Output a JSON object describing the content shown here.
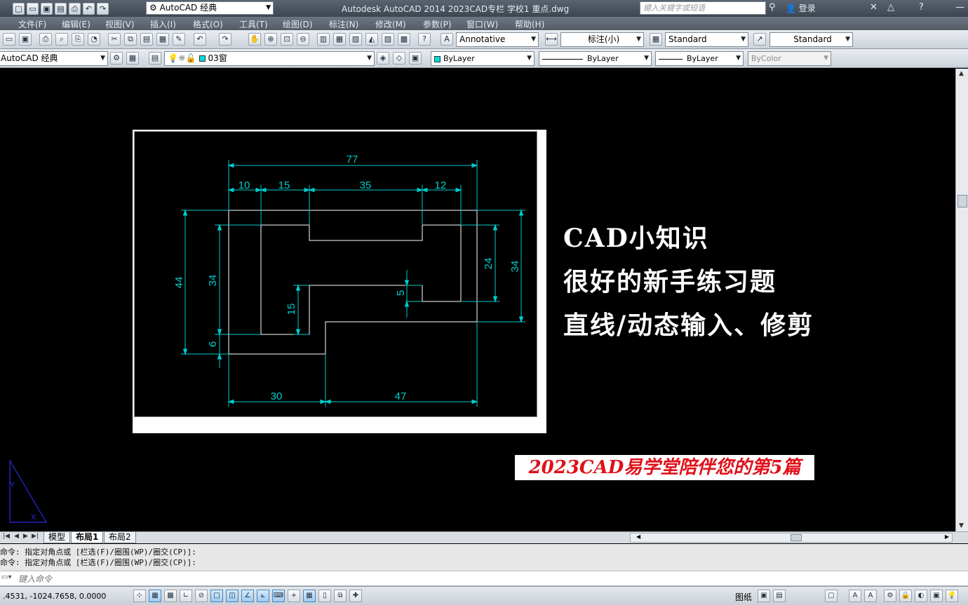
{
  "titlebar": {
    "workspace": "AutoCAD 经典",
    "title": "Autodesk AutoCAD 2014    2023CAD专栏 学校1 重点.dwg",
    "search_placeholder": "键入关键字或短语",
    "login": "登录",
    "icons": [
      "new-icon",
      "open-icon",
      "save-icon",
      "save-as-icon",
      "print-icon",
      "undo-icon",
      "redo-icon"
    ]
  },
  "menu": [
    "文件(F)",
    "编辑(E)",
    "视图(V)",
    "插入(I)",
    "格式(O)",
    "工具(T)",
    "绘图(D)",
    "标注(N)",
    "修改(M)",
    "参数(P)",
    "窗口(W)",
    "帮助(H)"
  ],
  "toolbar1": {
    "text_style": "Annotative",
    "dim_style": "标注(小)",
    "table_style": "Standard",
    "multileader_style": "Standard"
  },
  "toolbar2": {
    "workspace": "AutoCAD 经典",
    "layer": "03窗",
    "color": "ByLayer",
    "linetype": "ByLayer",
    "lineweight": "ByLayer",
    "plotstyle": "ByColor"
  },
  "drawing": {
    "dimensions": {
      "top_total": "77",
      "top_a": "10",
      "top_b": "15",
      "top_c": "35",
      "top_d": "12",
      "left_44": "44",
      "left_34": "34",
      "left_6": "6",
      "inner_15": "15",
      "inner_5": "5",
      "right_24": "24",
      "right_34": "34",
      "bottom_30": "30",
      "bottom_47": "47"
    },
    "line_color": "#ffffff",
    "dim_color": "#00cccc"
  },
  "notes": {
    "line1": "CAD小知识",
    "line2": "很好的新手练习题",
    "line3": "直线/动态输入、修剪"
  },
  "banner": "2023CAD易学堂陪伴您的第5篇",
  "tabs": [
    "模型",
    "布局1",
    "布局2"
  ],
  "active_tab": "布局1",
  "command": {
    "history": [
      "命令: 指定对角点或 [栏选(F)/圈围(WP)/圈交(CP)]:",
      "命令: 指定对角点或 [栏选(F)/圈围(WP)/圈交(CP)]:"
    ],
    "placeholder": "键入命令"
  },
  "status": {
    "coords": ".4531,   -1024.7658,  0.0000",
    "paper": "图纸"
  }
}
